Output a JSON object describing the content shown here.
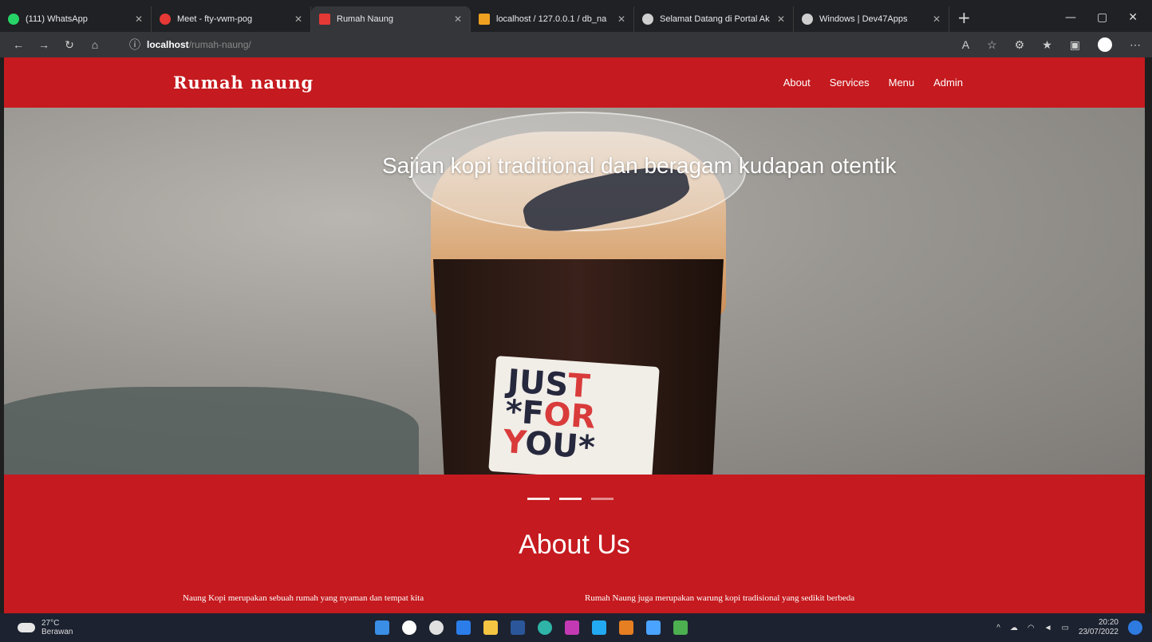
{
  "browser": {
    "tabs": [
      {
        "title": "(111) WhatsApp",
        "color": "#25d366"
      },
      {
        "title": "Meet - fty-vwm-pog",
        "color": "#e53935"
      },
      {
        "title": "Rumah Naung",
        "color": "#e53935"
      },
      {
        "title": "localhost / 127.0.0.1 / db_na",
        "color": "#f0a020"
      },
      {
        "title": "Selamat Datang di Portal Ak",
        "color": "#cfcfcf"
      },
      {
        "title": "Windows | Dev47Apps",
        "color": "#cfcfcf"
      }
    ],
    "active_tab": 2,
    "url_host": "localhost",
    "url_path": "/rumah-naung/"
  },
  "site": {
    "brand": "Rumah naung",
    "menu": [
      "About",
      "Services",
      "Menu",
      "Admin"
    ],
    "hero_caption": "Sajian kopi traditional dan beragam kudapan otentik",
    "sticker": {
      "line1a": "JUS",
      "line1b": "T",
      "line2a": "*F",
      "line2b": "OR",
      "line3a": "Y",
      "line3b": "OU*"
    },
    "about_title": "About Us",
    "about_left": "Naung Kopi merupakan sebuah rumah yang nyaman dan tempat kita",
    "about_right": "Rumah Naung juga merupakan warung kopi tradisional yang sedikit berbeda"
  },
  "taskbar": {
    "temp": "27°C",
    "weather": "Berawan",
    "time": "20:20",
    "date": "23/07/2022"
  },
  "colors": {
    "brand_red": "#c51a1f"
  }
}
